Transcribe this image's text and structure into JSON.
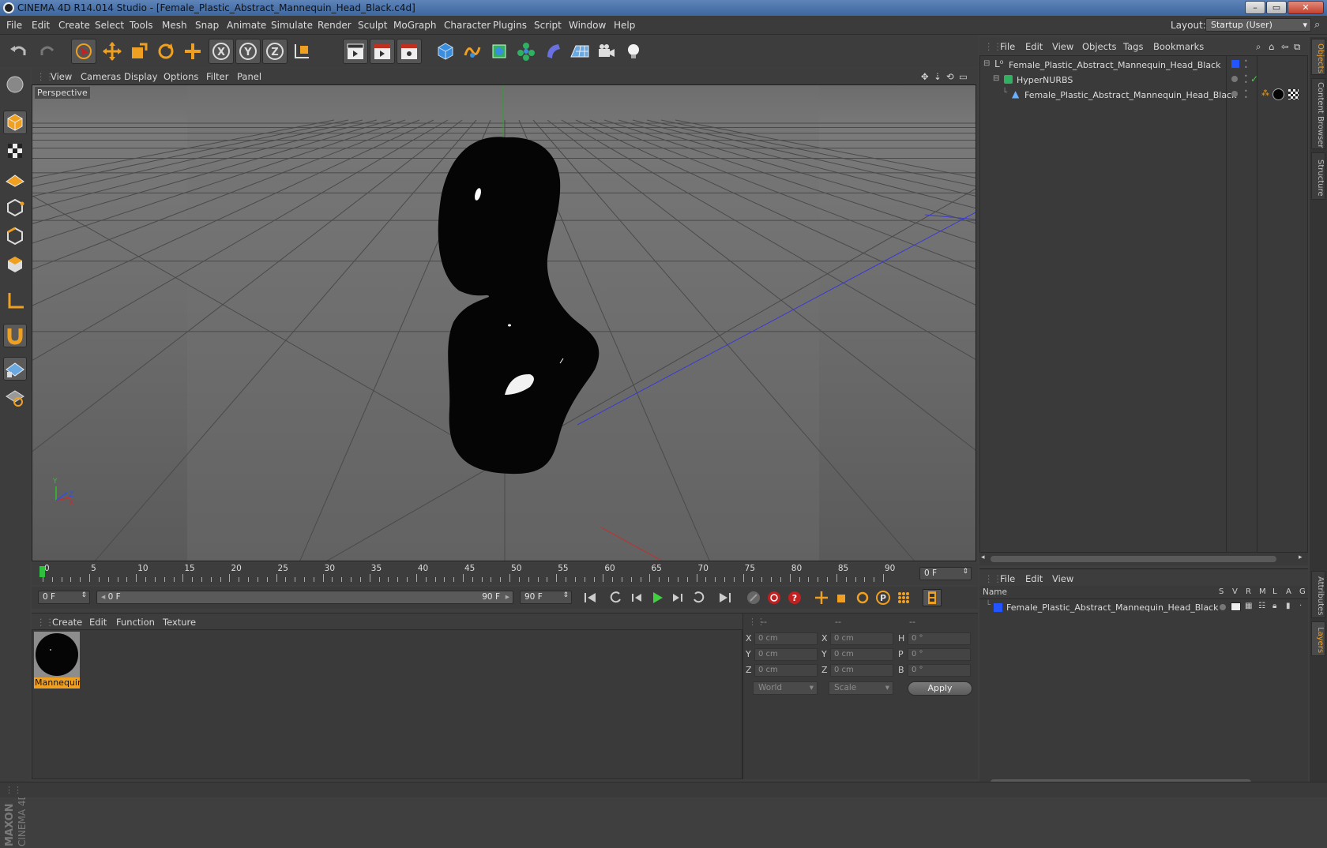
{
  "window": {
    "title": "CINEMA 4D R14.014 Studio - [Female_Plastic_Abstract_Mannequin_Head_Black.c4d]",
    "min_label": "–",
    "max_label": "▭",
    "close_label": "✕"
  },
  "menubar": {
    "items": [
      "File",
      "Edit",
      "Create",
      "Select",
      "Tools",
      "Mesh",
      "Snap",
      "Animate",
      "Simulate",
      "Render",
      "Sculpt",
      "MoGraph",
      "Character",
      "Plugins",
      "Script",
      "Window",
      "Help"
    ],
    "layout_label": "Layout:",
    "layout_value": "Startup (User)"
  },
  "viewport": {
    "menu": [
      "View",
      "Cameras",
      "Display",
      "Options",
      "Filter",
      "Panel"
    ],
    "label": "Perspective",
    "axis_x": "X",
    "axis_y": "Y",
    "axis_z": "Z"
  },
  "timeline": {
    "ticks": [
      "0",
      "5",
      "10",
      "15",
      "20",
      "25",
      "30",
      "35",
      "40",
      "45",
      "50",
      "55",
      "60",
      "65",
      "70",
      "75",
      "80",
      "85",
      "90"
    ],
    "current_frame": "0 F"
  },
  "transport": {
    "start_field": "0 F",
    "range_start": "0 F",
    "range_end": "90 F",
    "end_field": "90 F"
  },
  "material_manager": {
    "menu": [
      "Create",
      "Edit",
      "Function",
      "Texture"
    ],
    "material_name": "Mannequin"
  },
  "coordinates": {
    "col_headers": [
      "--",
      "--",
      "--"
    ],
    "rows": [
      {
        "l1": "X",
        "v1": "0 cm",
        "l2": "X",
        "v2": "0 cm",
        "l3": "H",
        "v3": "0 °"
      },
      {
        "l1": "Y",
        "v1": "0 cm",
        "l2": "Y",
        "v2": "0 cm",
        "l3": "P",
        "v3": "0 °"
      },
      {
        "l1": "Z",
        "v1": "0 cm",
        "l2": "Z",
        "v2": "0 cm",
        "l3": "B",
        "v3": "0 °"
      }
    ],
    "mode_dropdown": "World",
    "scale_dropdown": "Scale",
    "apply_label": "Apply"
  },
  "object_manager": {
    "menu": [
      "File",
      "Edit",
      "View",
      "Objects",
      "Tags",
      "Bookmarks"
    ],
    "rows": [
      {
        "name": "Female_Plastic_Abstract_Mannequin_Head_Black"
      },
      {
        "name": "HyperNURBS"
      },
      {
        "name": "Female_Plastic_Abstract_Mannequin_Head_Black"
      }
    ]
  },
  "layer_manager": {
    "menu": [
      "File",
      "Edit",
      "View"
    ],
    "name_header": "Name",
    "col_headers": [
      "S",
      "V",
      "R",
      "M",
      "L",
      "A",
      "G"
    ],
    "rows": [
      {
        "name": "Female_Plastic_Abstract_Mannequin_Head_Black"
      }
    ]
  },
  "side_tabs": [
    "Objects",
    "Content Browser",
    "Structure",
    "Attributes",
    "Layers"
  ],
  "branding": {
    "top": "MAXON",
    "bottom": "CINEMA 4D"
  },
  "colors": {
    "accent": "#f0a020",
    "layer_color": "#2255ff",
    "x_axis": "#c03030",
    "y_axis": "#30a030",
    "z_axis": "#3050c0"
  }
}
